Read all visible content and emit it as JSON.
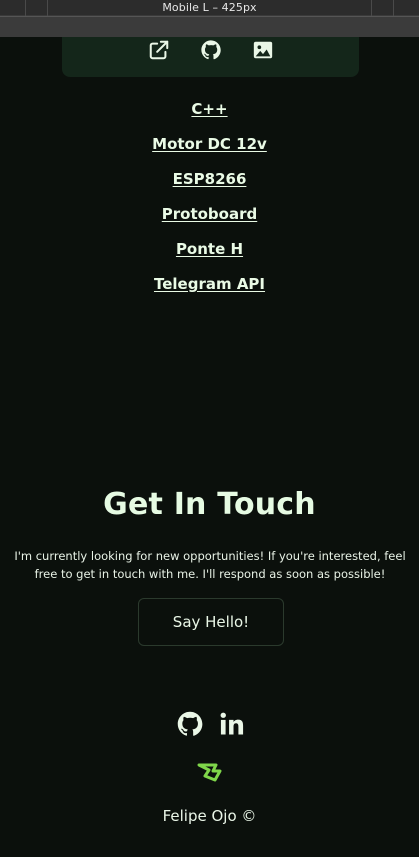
{
  "devtools": {
    "viewport_label": "Mobile L – 425px"
  },
  "project_card": {
    "icons": [
      "external-link-icon",
      "github-icon",
      "image-icon"
    ]
  },
  "technologies": [
    "C++",
    "Motor DC 12v",
    "ESP8266",
    "Protoboard",
    "Ponte H",
    "Telegram API"
  ],
  "contact": {
    "heading": "Get In Touch",
    "paragraph": "I'm currently looking for new opportunities! If you're interested, feel free to get in touch with me. I'll respond as soon as possible!",
    "button_label": "Say Hello!"
  },
  "social_icons": [
    "github-icon",
    "linkedin-icon"
  ],
  "footer": {
    "text": "Felipe Ojo ©"
  },
  "colors": {
    "background": "#0b100c",
    "card": "#14261a",
    "accent": "#7fd64a",
    "text": "#e9f5e6"
  }
}
